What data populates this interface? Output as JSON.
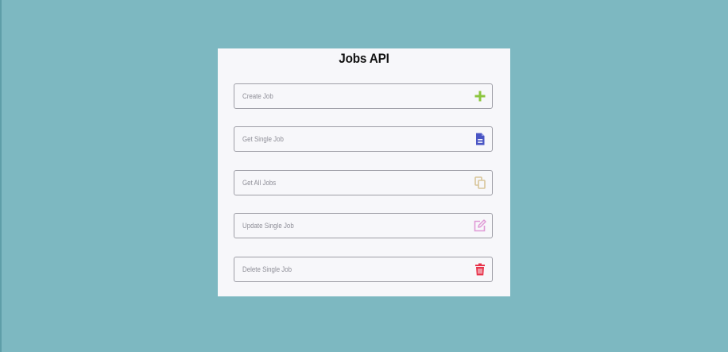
{
  "app": {
    "title": "Jobs API"
  },
  "actions": [
    {
      "label": "Create Job",
      "icon": "plus-icon",
      "color": "#8cc63f"
    },
    {
      "label": "Get Single Job",
      "icon": "document-icon",
      "color": "#4a55c4"
    },
    {
      "label": "Get All Jobs",
      "icon": "copy-icon",
      "color": "#d8c59a"
    },
    {
      "label": "Update Single Job",
      "icon": "edit-icon",
      "color": "#e09ad6"
    },
    {
      "label": "Delete Single Job",
      "icon": "trash-icon",
      "color": "#e8334a"
    }
  ],
  "colors": {
    "background": "#7db8c1",
    "panel": "#f7f7fa"
  }
}
